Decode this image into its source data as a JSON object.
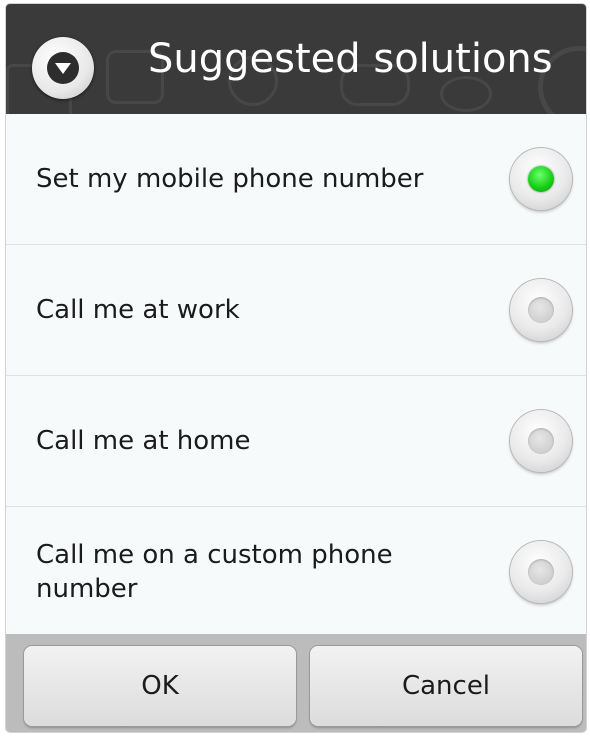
{
  "dialog": {
    "title": "Suggested solutions",
    "title_icon": "dropdown-circle-icon"
  },
  "options": [
    {
      "label": "Set my mobile phone number",
      "selected": true
    },
    {
      "label": "Call me at work",
      "selected": false
    },
    {
      "label": "Call me at home",
      "selected": false
    },
    {
      "label": "Call me on a custom phone number",
      "selected": false
    }
  ],
  "buttons": {
    "ok_label": "OK",
    "cancel_label": "Cancel"
  },
  "colors": {
    "title_bar": "#3a3a3a",
    "selected_radio": "#19d119",
    "button_bar": "#bcbcbc"
  }
}
